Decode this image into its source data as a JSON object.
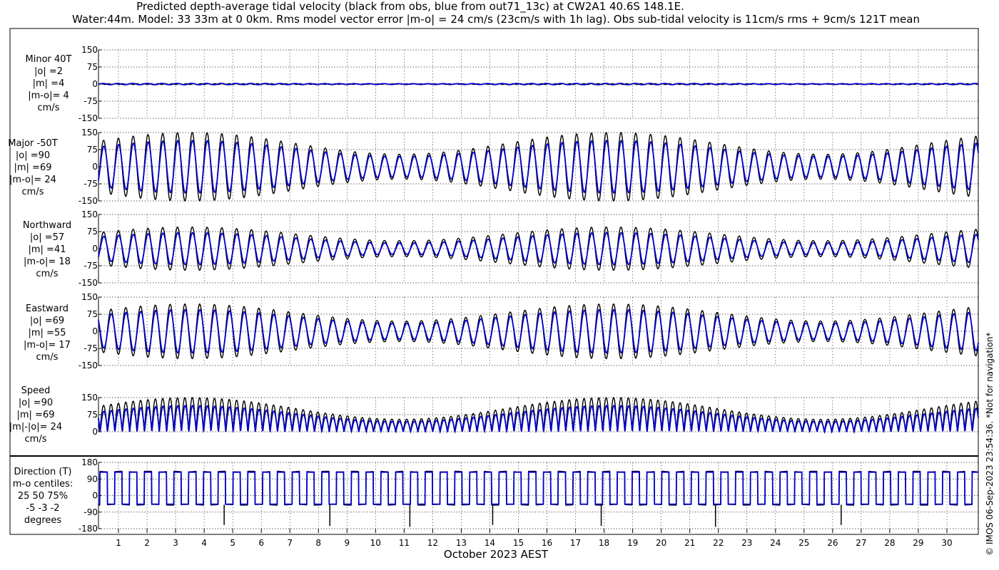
{
  "header": {
    "title_line1": "Predicted depth-average tidal velocity (black from obs, blue from out71_13c) at CW2A1 40.6S 148.1E.",
    "title_line2": "Water:44m. Model: 33 33m at 0 0km. Rms model vector error |m-o| = 24 cm/s (23cm/s with 1h lag). Obs sub-tidal velocity is 11cm/s rms + 9cm/s 121T mean"
  },
  "credit": "© IMOS 06-Sep-2023 23:54:36. *Not for navigation*",
  "colors": {
    "obs": "#000000",
    "model": "#0000cc",
    "grid": "#000000"
  },
  "chart_data": {
    "type": "line",
    "xlabel": "October 2023 AEST",
    "x_ticks": [
      "1",
      "2",
      "3",
      "4",
      "5",
      "6",
      "7",
      "8",
      "9",
      "10",
      "11",
      "12",
      "13",
      "14",
      "15",
      "16",
      "17",
      "18",
      "19",
      "20",
      "21",
      "22",
      "23",
      "24",
      "25",
      "26",
      "27",
      "28",
      "29",
      "30"
    ],
    "xlim_days": [
      0.3,
      31.1
    ],
    "series_legend": [
      "obs (black)",
      "model out71_13c (blue)"
    ],
    "panels": [
      {
        "key": "minor",
        "label_lines": [
          "Minor 40T",
          "|o| =2",
          "|m| =4",
          "|m-o|= 4",
          "cm/s"
        ],
        "ylim": [
          -150,
          150
        ],
        "ticks": [
          "150",
          "75",
          "0",
          "-75",
          "-150"
        ],
        "tickvals": [
          150,
          75,
          0,
          -75,
          -150
        ],
        "obs_amplitude_range": [
          2,
          4
        ],
        "model_amplitude_range": [
          3,
          5
        ],
        "mean": 0
      },
      {
        "key": "major",
        "label_lines": [
          "Major -50T",
          "|o| =90",
          "|m| =69",
          "|m-o|= 24",
          "cm/s"
        ],
        "ylim": [
          -150,
          150
        ],
        "ticks": [
          "150",
          "75",
          "0",
          "-75",
          "-150"
        ],
        "tickvals": [
          150,
          75,
          0,
          -75,
          -150
        ],
        "obs_amplitude_range": [
          55,
          150
        ],
        "model_amplitude_range": [
          45,
          115
        ],
        "mean": 0
      },
      {
        "key": "north",
        "label_lines": [
          "Northward",
          "|o| =57",
          "|m| =41",
          "|m-o|= 18",
          "cm/s"
        ],
        "ylim": [
          -150,
          150
        ],
        "ticks": [
          "150",
          "75",
          "0",
          "-75",
          "-150"
        ],
        "tickvals": [
          150,
          75,
          0,
          -75,
          -150
        ],
        "obs_amplitude_range": [
          35,
          95
        ],
        "model_amplitude_range": [
          25,
          70
        ],
        "mean": 0
      },
      {
        "key": "east",
        "label_lines": [
          "Eastward",
          "|o| =69",
          "|m| =55",
          "|m-o|= 17",
          "cm/s"
        ],
        "ylim": [
          -150,
          150
        ],
        "ticks": [
          "150",
          "75",
          "0",
          "-75",
          "-150"
        ],
        "tickvals": [
          150,
          75,
          0,
          -75,
          -150
        ],
        "obs_amplitude_range": [
          45,
          120
        ],
        "model_amplitude_range": [
          35,
          95
        ],
        "mean": 0
      },
      {
        "key": "speed",
        "label_lines": [
          "Speed",
          "|o| =90",
          "|m| =69",
          "|m|-|o|= 24",
          "cm/s"
        ],
        "ylim": [
          0,
          150
        ],
        "ticks": [
          "150",
          "75",
          "0"
        ],
        "tickvals": [
          150,
          75,
          0
        ],
        "obs_amplitude_range": [
          55,
          150
        ],
        "model_amplitude_range": [
          45,
          115
        ],
        "mean": 0
      },
      {
        "key": "direction",
        "label_lines": [
          "Direction (T)",
          "m-o centiles:",
          "25  50  75%",
          "-5 -3 -2",
          "degrees"
        ],
        "ylim": [
          -180,
          180
        ],
        "ticks": [
          "180",
          "90",
          "0",
          "-90",
          "-180"
        ],
        "tickvals": [
          180,
          90,
          0,
          -90,
          -180
        ],
        "flood_direction": 130,
        "ebb_direction": -50
      }
    ]
  }
}
